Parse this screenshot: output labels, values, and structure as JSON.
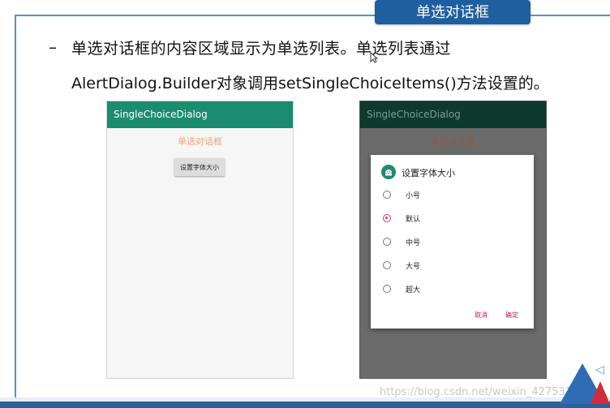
{
  "slide": {
    "title_tab": "单选对话框",
    "bullet_dash": "–",
    "bullet_line1": "单选对话框的内容区域显示为单选列表。单选列表通过",
    "bullet_line2": "AlertDialog.Builder对象调用setSingleChoiceItems()方法设置的。",
    "watermark": "https://blog.csdn.net/weixin_42753193"
  },
  "phone1": {
    "app_title": "SingleChoiceDialog",
    "label": "单选对话框",
    "button_label": "设置字体大小"
  },
  "phone2": {
    "app_title": "SingleChoiceDialog",
    "label": "单选对话框",
    "dialog": {
      "title": "设置字体大小",
      "options": [
        {
          "label": "小号",
          "checked": false
        },
        {
          "label": "默认",
          "checked": true
        },
        {
          "label": "中号",
          "checked": false
        },
        {
          "label": "大号",
          "checked": false
        },
        {
          "label": "超大",
          "checked": false
        }
      ],
      "cancel_label": "取消",
      "ok_label": "确定"
    }
  },
  "colors": {
    "accent_green": "#1b8c6f",
    "radio_checked": "#d6336c",
    "title_tab_bg": "#1f5f9f"
  },
  "icons": {
    "dialog_icon": "android-icon",
    "cursor": "mouse-cursor-icon"
  }
}
